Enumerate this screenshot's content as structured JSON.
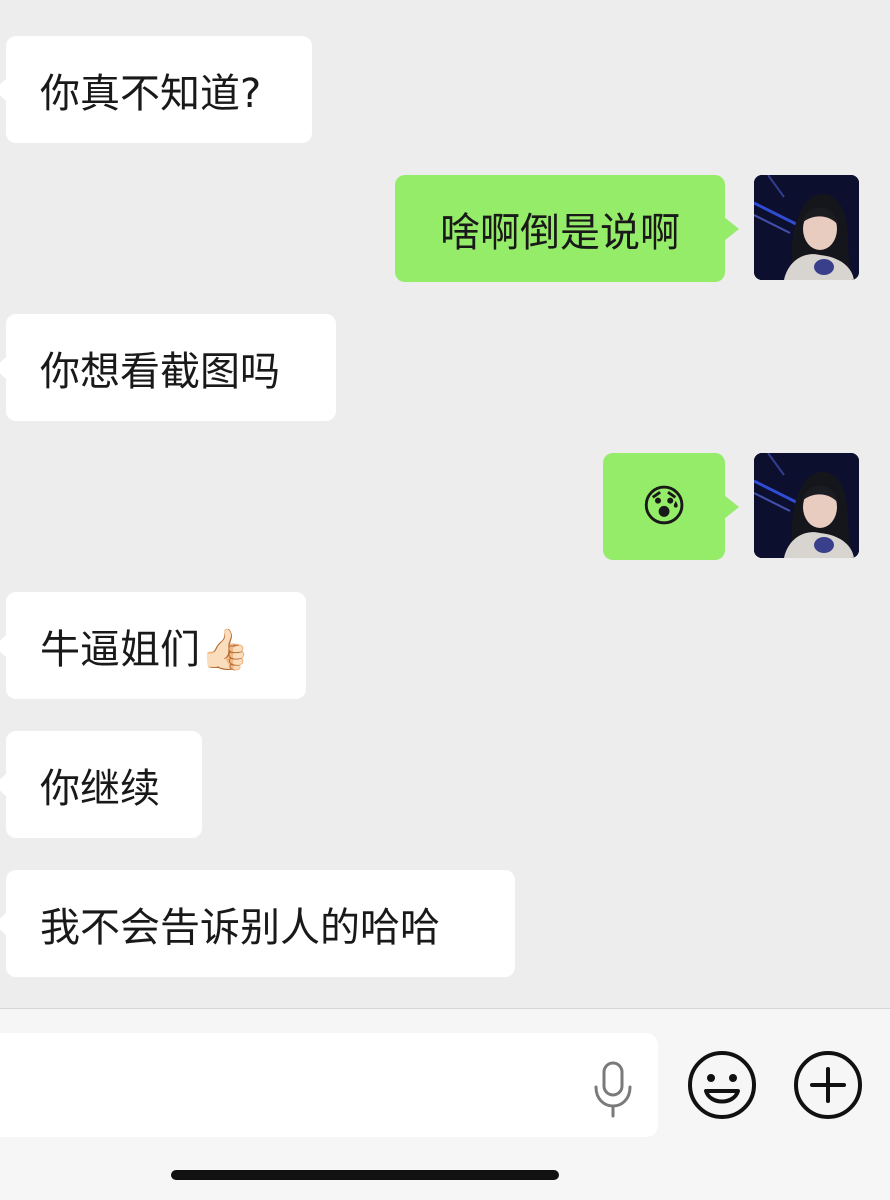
{
  "chat": {
    "messages": [
      {
        "side": "in",
        "text": "你真不知道?"
      },
      {
        "side": "out",
        "text": "啥啊倒是说啊"
      },
      {
        "side": "in",
        "text": "你想看截图吗"
      },
      {
        "side": "out",
        "text": "😰"
      },
      {
        "side": "in",
        "text": "牛逼姐们👍🏻"
      },
      {
        "side": "in",
        "text": "你继续"
      },
      {
        "side": "in",
        "text": "我不会告诉别人的哈哈"
      }
    ]
  },
  "input_bar": {
    "voice_icon": "microphone-icon",
    "emoji_icon": "smiley-face-icon",
    "more_icon": "plus-circle-icon"
  },
  "colors": {
    "background": "#ededed",
    "incoming_bubble": "#ffffff",
    "outgoing_bubble": "#95ec69"
  }
}
